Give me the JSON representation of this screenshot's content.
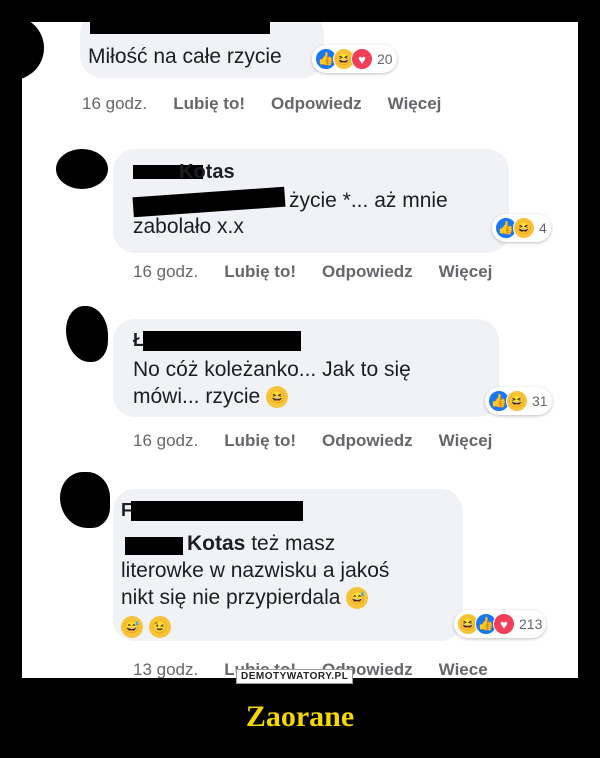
{
  "comments": [
    {
      "text": "Miłość na całe rzycie",
      "reaction_count": "20",
      "time": "16 godz.",
      "like": "Lubię to!",
      "reply": "Odpowiedz",
      "more": "Więcej"
    },
    {
      "name": "Kotas",
      "text_line1_end": "życie *... aż mnie",
      "text_line2": "zabolało x.x",
      "reaction_count": "4",
      "time": "16 godz.",
      "like": "Lubię to!",
      "reply": "Odpowiedz",
      "more": "Więcej"
    },
    {
      "name_initial": "Ł",
      "text": "No cóż koleżanko... Jak to się\nmówi... rzycie",
      "reaction_count": "31",
      "time": "16 godz.",
      "like": "Lubię to!",
      "reply": "Odpowiedz",
      "more": "Więcej"
    },
    {
      "name_initial": "F",
      "mention": "Kotas",
      "text_line1_end": "też masz",
      "text_rest": "literowke w nazwisku a jakoś\nnikt się nie przypierdala",
      "reaction_count": "213",
      "time": "13 godz.",
      "like": "Lubie to!",
      "reply": "Odpowiedz",
      "more": "Wiece"
    }
  ],
  "watermark": "DEMOTYWATORY.PL",
  "caption": "Zaorane",
  "colors": {
    "like": "#1877f2",
    "haha": "#f7c33b",
    "love": "#f33e58",
    "caption": "#f5d800"
  },
  "icons": [
    "like-icon",
    "haha-icon",
    "love-icon",
    "laughing-emoji-icon",
    "sweat-smile-emoji-icon",
    "wink-emoji-icon"
  ]
}
